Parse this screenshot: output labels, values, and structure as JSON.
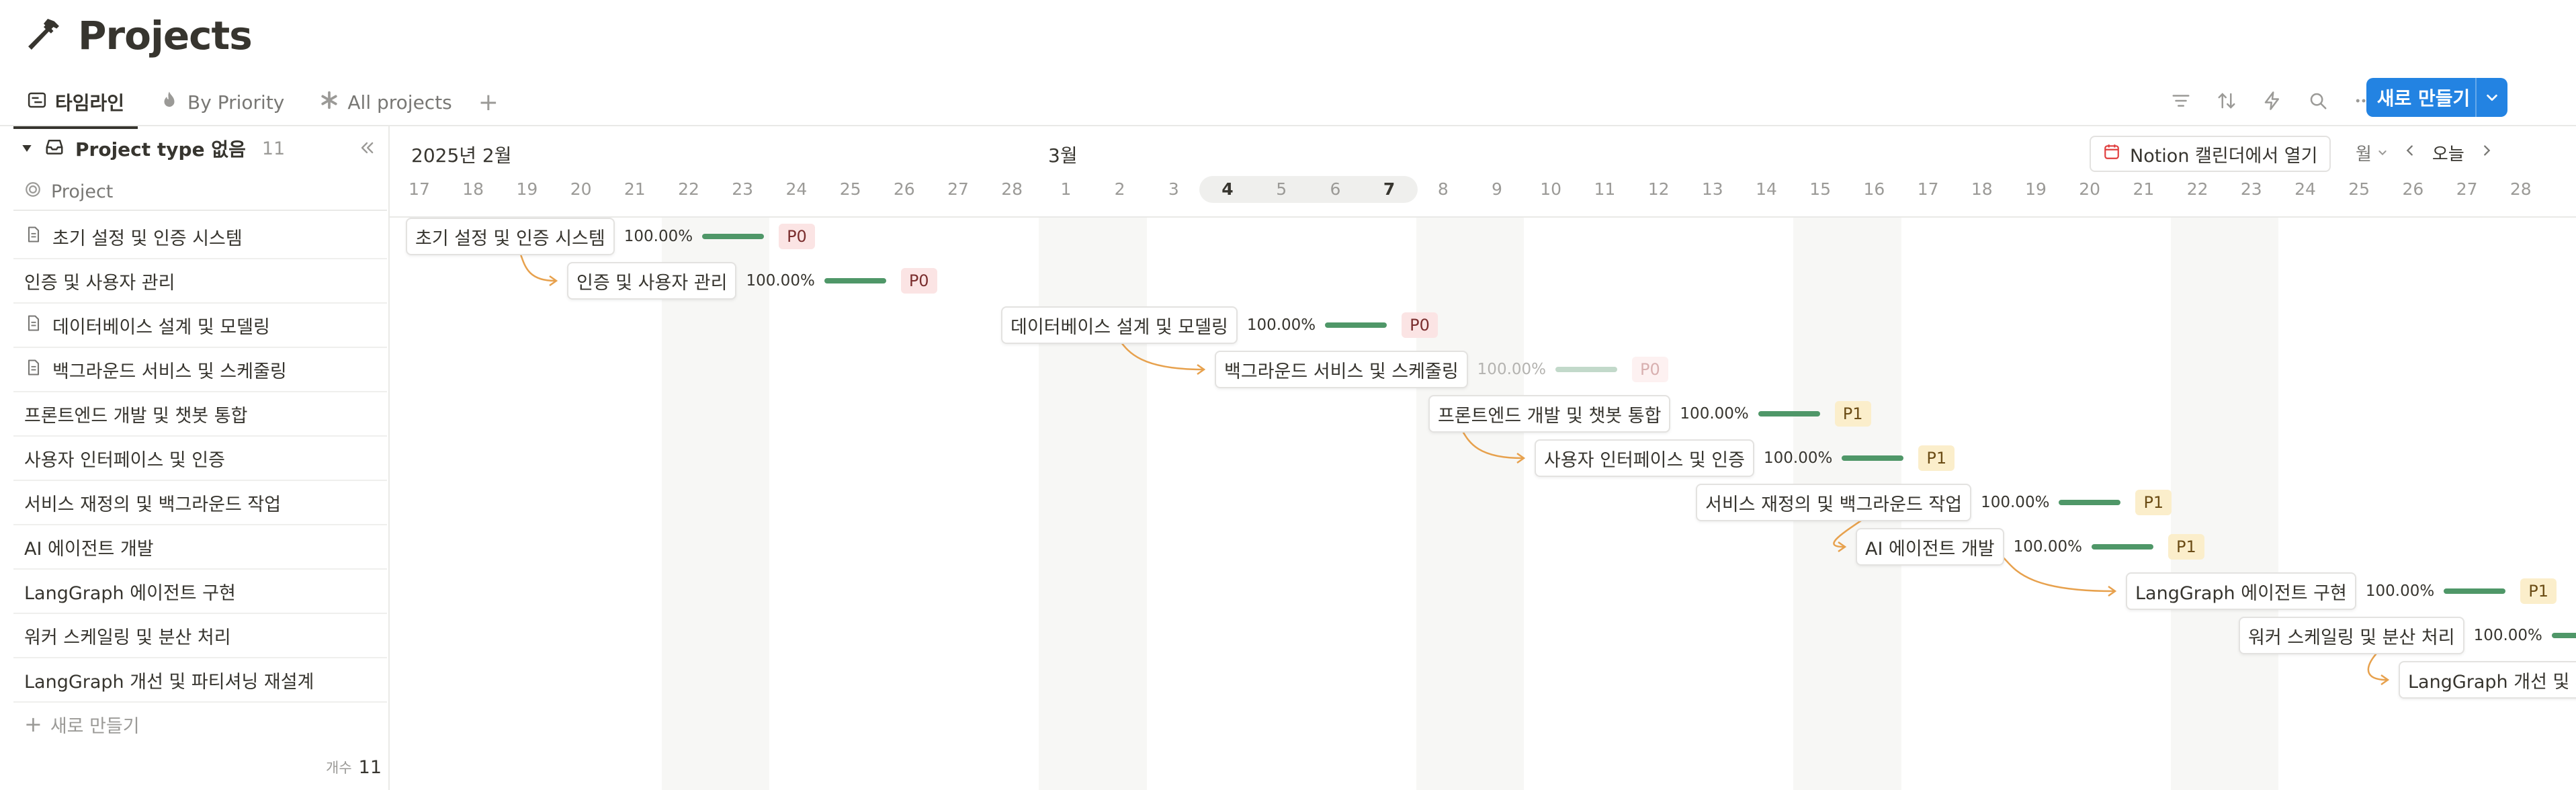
{
  "header": {
    "title": "Projects",
    "title_icon": "hammer-icon"
  },
  "tabs": [
    {
      "label": "타임라인",
      "icon": "timeline-icon",
      "active": true
    },
    {
      "label": "By Priority",
      "icon": "fire-icon",
      "active": false
    },
    {
      "label": "All projects",
      "icon": "asterisk-icon",
      "active": false
    }
  ],
  "toolbar": {
    "icons": [
      "filter-icon",
      "sort-icon",
      "automation-icon",
      "search-icon",
      "more-icon"
    ],
    "new_button": "새로 만들기"
  },
  "group": {
    "label": "Project type 없음",
    "count": "11"
  },
  "column_header": "Project",
  "rows": [
    {
      "label": "초기 설정 및 인증 시스템",
      "has_icon": true
    },
    {
      "label": "인증 및 사용자 관리",
      "has_icon": false
    },
    {
      "label": "데이터베이스 설계 및 모델링",
      "has_icon": true
    },
    {
      "label": "백그라운드 서비스 및 스케줄링",
      "has_icon": true
    },
    {
      "label": "프론트엔드 개발 및 챗봇 통합",
      "has_icon": false
    },
    {
      "label": "사용자 인터페이스 및 인증",
      "has_icon": false
    },
    {
      "label": "서비스 재정의 및 백그라운드 작업",
      "has_icon": false
    },
    {
      "label": "AI 에이전트 개발",
      "has_icon": false
    },
    {
      "label": "LangGraph 에이전트 구현",
      "has_icon": false
    },
    {
      "label": "워커 스케일링 및 분산 처리",
      "has_icon": false
    },
    {
      "label": "LangGraph 개선 및 파티셔닝 재설계",
      "has_icon": false
    }
  ],
  "new_row": "새로 만들기",
  "count": {
    "label": "개수",
    "value": "11"
  },
  "timeline": {
    "months": [
      "2025년 2월",
      "3월"
    ],
    "days": [
      "17",
      "18",
      "19",
      "20",
      "21",
      "22",
      "23",
      "24",
      "25",
      "26",
      "27",
      "28",
      "1",
      "2",
      "3",
      "4",
      "5",
      "6",
      "7",
      "8",
      "9",
      "10",
      "11",
      "12",
      "13",
      "14",
      "15",
      "16",
      "17",
      "18",
      "19",
      "20",
      "21",
      "22",
      "23",
      "24",
      "25",
      "26",
      "27",
      "28"
    ],
    "calendar_button": "Notion 캘린더에서 열기",
    "view": "월",
    "today": "오늘",
    "items": [
      {
        "name": "초기 설정 및 인증 시스템",
        "percent": "100.00%",
        "priority": "P0",
        "progress": 1.0
      },
      {
        "name": "인증 및 사용자 관리",
        "percent": "100.00%",
        "priority": "P0",
        "progress": 1.0
      },
      {
        "name": "데이터베이스 설계 및 모델링",
        "percent": "100.00%",
        "priority": "P0",
        "progress": 1.0
      },
      {
        "name": "백그라운드 서비스 및 스케줄링",
        "percent": "100.00%",
        "priority": "P0",
        "progress": 1.0
      },
      {
        "name": "프론트엔드 개발 및 챗봇 통합",
        "percent": "100.00%",
        "priority": "P1",
        "progress": 1.0
      },
      {
        "name": "사용자 인터페이스 및 인증",
        "percent": "100.00%",
        "priority": "P1",
        "progress": 1.0
      },
      {
        "name": "서비스 재정의 및 백그라운드 작업",
        "percent": "100.00%",
        "priority": "P1",
        "progress": 1.0
      },
      {
        "name": "AI 에이전트 개발",
        "percent": "100.00%",
        "priority": "P1",
        "progress": 1.0
      },
      {
        "name": "LangGraph 에이전트 구현",
        "percent": "100.00%",
        "priority": "P1",
        "progress": 1.0
      },
      {
        "name": "워커 스케일링 및 분산 처리",
        "percent": "100.00%",
        "priority": "",
        "progress": 1.0
      },
      {
        "name": "LangGraph 개선 및 파티셔닝 재설계",
        "percent": "",
        "priority": "",
        "progress": 1.0
      }
    ]
  },
  "colors": {
    "accent": "#2383e2",
    "progress": "#4f9768",
    "dependency": "#e7a14d",
    "p0_bg": "#fbe4e4",
    "p1_bg": "#fbeecb"
  }
}
